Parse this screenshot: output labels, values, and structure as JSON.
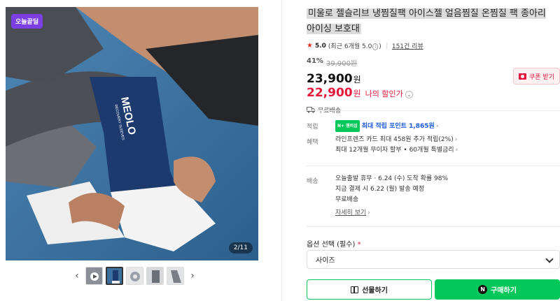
{
  "gallery": {
    "badge": "오늘끝딜",
    "counter": "2/11",
    "brand_text": "MEOLO",
    "brand_sub": "RECOVERY SLEEVES",
    "prev_label": "‹",
    "next_label": "›",
    "thumb_count": 5,
    "active_thumb": 2
  },
  "product": {
    "title": "미울로 젤슬리브 냉찜질팩 아이스젤 얼음찜질 온찜질 팩 종아리 아이싱 보호대",
    "rating": "5.0",
    "rating_note": "(최근 6개월 5.0",
    "rating_note_end": ")",
    "reviews": "151건 리뷰",
    "discount": "41%",
    "original_price": "39,900원",
    "price": "23,900",
    "price_unit": "원",
    "my_price": "22,900",
    "my_price_unit": "원",
    "my_price_label": "나의 할인가",
    "coupon_label": "쿠폰 받기",
    "shipping": "무료배송"
  },
  "benefits": {
    "points_label": "적립",
    "npay_badge": "N+ 멤버십",
    "points_value": "최대 적립 포인트 1,865원",
    "benefit_label": "혜택",
    "benefit_line1": "라인프렌즈 카드 최대 458원 추가 적립(2%)",
    "benefit_line2": "최대 12개월 무이자 할부 • 60개월 특별금리"
  },
  "delivery": {
    "label": "배송",
    "line1": "오늘출발 휴무 · 6.24 (수) 도착 확률 98%",
    "line2": "지금 결제 시 6.22 (월) 발송 예정",
    "line3": "무료배송",
    "details_link": "자세히 보기"
  },
  "options": {
    "label": "옵션 선택 (필수)",
    "required_mark": "*",
    "select_value": "사이즈"
  },
  "actions": {
    "gift": "선물하기",
    "buy": "구매하기"
  },
  "colors": {
    "accent_green": "#03c75a",
    "price_red": "#e5173b",
    "badge_purple": "#7b3fe4"
  }
}
